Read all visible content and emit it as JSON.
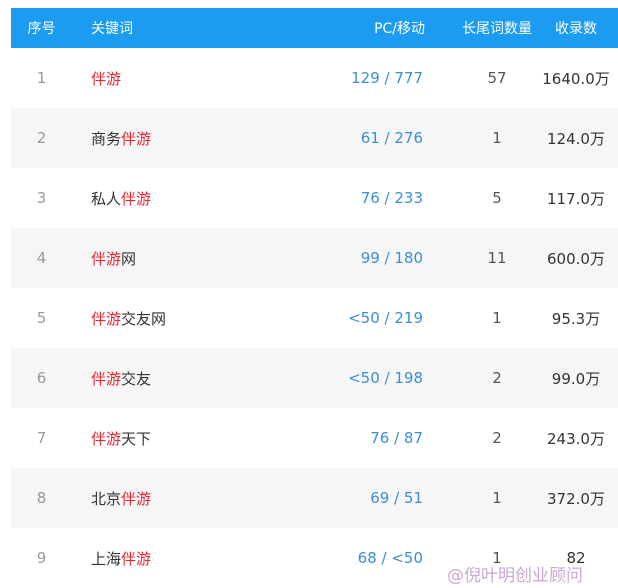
{
  "header": {
    "col_index": "序号",
    "col_keyword": "关键词",
    "col_pc_mobile": "PC/移动",
    "col_longtail": "长尾词数量",
    "col_indexed": "收录数"
  },
  "rows": [
    {
      "index": "1",
      "prefix": "",
      "highlight": "伴游",
      "suffix": "",
      "pc_mobile": "129 / 777",
      "longtail": "57",
      "indexed": "1640.0万"
    },
    {
      "index": "2",
      "prefix": "商务",
      "highlight": "伴游",
      "suffix": "",
      "pc_mobile": "61 / 276",
      "longtail": "1",
      "indexed": "124.0万"
    },
    {
      "index": "3",
      "prefix": "私人",
      "highlight": "伴游",
      "suffix": "",
      "pc_mobile": "76 / 233",
      "longtail": "5",
      "indexed": "117.0万"
    },
    {
      "index": "4",
      "prefix": "",
      "highlight": "伴游",
      "suffix": "网",
      "pc_mobile": "99 / 180",
      "longtail": "11",
      "indexed": "600.0万"
    },
    {
      "index": "5",
      "prefix": "",
      "highlight": "伴游",
      "suffix": "交友网",
      "pc_mobile": "<50 / 219",
      "longtail": "1",
      "indexed": "95.3万"
    },
    {
      "index": "6",
      "prefix": "",
      "highlight": "伴游",
      "suffix": "交友",
      "pc_mobile": "<50 / 198",
      "longtail": "2",
      "indexed": "99.0万"
    },
    {
      "index": "7",
      "prefix": "",
      "highlight": "伴游",
      "suffix": "天下",
      "pc_mobile": "76 / 87",
      "longtail": "2",
      "indexed": "243.0万"
    },
    {
      "index": "8",
      "prefix": "北京",
      "highlight": "伴游",
      "suffix": "",
      "pc_mobile": "69 / 51",
      "longtail": "1",
      "indexed": "372.0万"
    },
    {
      "index": "9",
      "prefix": "上海",
      "highlight": "伴游",
      "suffix": "",
      "pc_mobile": "68 / <50",
      "longtail": "1",
      "indexed": "82"
    }
  ],
  "watermark": "@倪叶明创业顾问",
  "colors": {
    "header_bg": "#1c9cf0",
    "highlight": "#e8242f",
    "link": "#3a8fd6",
    "row_alt": "#f6f6f6"
  }
}
